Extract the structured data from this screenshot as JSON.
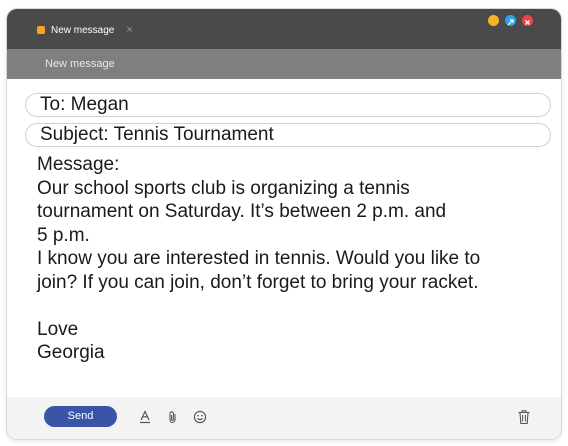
{
  "tab": {
    "title": "New message",
    "close": "×"
  },
  "window_controls": {
    "minimize": "",
    "maximize": "",
    "close": ""
  },
  "subheader": {
    "title": "New message"
  },
  "to_field": {
    "text": "To: Megan"
  },
  "subject_field": {
    "text": "Subject: Tennis Tournament"
  },
  "message": {
    "lines": [
      "Message:",
      "Our school sports club is organizing a tennis",
      "tournament on Saturday. It’s between 2 p.m. and",
      "5 p.m.",
      "I know you are interested in tennis. Would you like to",
      "join? If you can join, don’t forget to bring your racket.",
      "",
      "Love",
      "Georgia"
    ]
  },
  "toolbar": {
    "send_label": "Send",
    "icons": [
      "text-format-icon",
      "attachment-icon",
      "emoji-icon",
      "trash-icon"
    ]
  },
  "colors": {
    "titlebar": "#4a4a4a",
    "subbar": "#7f7f7f",
    "send_button": "#3a55a8",
    "tab_icon": "#f0a72a"
  }
}
